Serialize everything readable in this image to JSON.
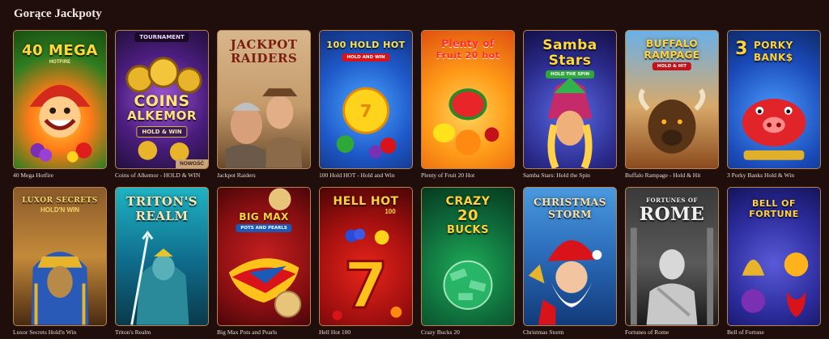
{
  "section_title": "Gorące Jackpoty",
  "games_row1": [
    {
      "name": "40 Mega Hotfire",
      "logo": "40 MEGA",
      "sub": "HOTFIRE"
    },
    {
      "name": "Coins of Alkemor - HOLD & WIN",
      "logo_top": "TOURNAMENT",
      "logo": "COINS",
      "logo2": "ALKEMOR",
      "sub": "HOLD & WIN",
      "badge": "NOWOŚĆ"
    },
    {
      "name": "Jackpot Raiders",
      "logo": "JACKPOT",
      "logo2": "RAIDERS"
    },
    {
      "name": "100 Hold HOT - Hold and Win",
      "logo": "100 HOLD HOT",
      "sub": "HOLD AND WIN"
    },
    {
      "name": "Plenty of Fruit 20 Hot",
      "logo": "Plenty of",
      "logo2": "Fruit 20 hot"
    },
    {
      "name": "Samba Stars: Hold the Spin",
      "logo": "Samba",
      "logo2": "Stars",
      "sub": "HOLD THE SPIN"
    },
    {
      "name": "Buffalo Rampage - Hold & Hit",
      "logo": "BUFFALO",
      "logo2": "RAMPAGE",
      "sub": "HOLD & HIT"
    },
    {
      "name": "3 Porky Banks Hold & Win",
      "logo": "3",
      "logo2": "PORKY",
      "logo3": "BANK$"
    }
  ],
  "games_row2": [
    {
      "name": "Luxor Secrets Hold'n Win",
      "logo": "LUXOR SECRETS",
      "sub": "HOLD'N WIN"
    },
    {
      "name": "Triton's Realm",
      "logo": "TRITON'S",
      "logo2": "REALM"
    },
    {
      "name": "Big Max Pots and Pearls",
      "logo": "BIG MAX",
      "sub": "POTS AND PEARLS"
    },
    {
      "name": "Hell Hot 100",
      "logo": "HELL HOT",
      "sub": "100"
    },
    {
      "name": "Crazy Bucks 20",
      "logo": "CRAZY",
      "logo2": "20",
      "logo3": "BUCKS"
    },
    {
      "name": "Christmas Storm",
      "logo": "CHRISTMAS",
      "logo2": "STORM"
    },
    {
      "name": "Fortunes of Rome",
      "logo": "FORTUNES OF",
      "logo2": "ROME"
    },
    {
      "name": "Bell of Fortune",
      "logo": "BELL OF",
      "logo2": "FORTUNE"
    }
  ],
  "colors": {
    "background": "#1f0e0b",
    "tile_border": "#b7854d",
    "caption": "#e9ddd3"
  }
}
